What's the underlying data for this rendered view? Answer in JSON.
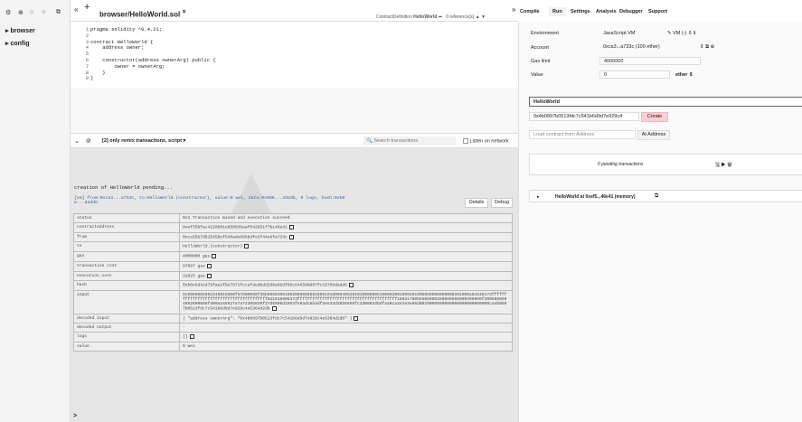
{
  "sidebar": {
    "toolbar_icons": [
      "gear-icon",
      "plus-icon",
      "github-icon",
      "swarm-icon",
      "copy-icon"
    ],
    "tree": [
      "browser",
      "config"
    ]
  },
  "tabs": {
    "prev_label": "«",
    "add_label": "+",
    "active": "browser/HelloWorld.sol",
    "close": "×",
    "next_label": "»"
  },
  "editor": {
    "header_left": "ContractDefinition",
    "header_name": "HelloWorld",
    "header_refs": "0 reference(s)",
    "lines": [
      {
        "n": "1",
        "t": "pragma solidity ^0.4.21;"
      },
      {
        "n": "2",
        "t": ""
      },
      {
        "n": "3",
        "t": "contract HelloWorld {"
      },
      {
        "n": "4",
        "t": "    address owner;"
      },
      {
        "n": "5",
        "t": ""
      },
      {
        "n": "6",
        "t": "    constructor(address ownerArg) public {"
      },
      {
        "n": "7",
        "t": "        owner = ownerArg;"
      },
      {
        "n": "8",
        "t": "    }"
      },
      {
        "n": "9",
        "t": "}"
      }
    ]
  },
  "terminal_bar": {
    "filter": "[2] only remix transactions, script",
    "search_placeholder": "Search transactions",
    "listen": "Listen on network"
  },
  "terminal": {
    "creation": "creation of HelloWorld pending...",
    "tx_line1": "[vm] from:0xca3...a733c, to:HelloWorld.(constructor), value:0 wei, data:0x608...4d2db, 0 logs, hash:0xb0",
    "tx_line2": "e...dadd6",
    "details": "Details",
    "debug": "Debug",
    "rows": [
      {
        "k": "status",
        "v": "0x1 Transaction mined and execution succeed"
      },
      {
        "k": "contractAddress",
        "v": "0xef35bfac4220981e850936aaf042951f7b146e41"
      },
      {
        "k": "from",
        "v": "0xca35b7d915458ef540ade6068dfe2f44e8fa733c"
      },
      {
        "k": "to",
        "v": "HelloWorld.(constructor)"
      },
      {
        "k": "gas",
        "v": "4000000 gas"
      },
      {
        "k": "transaction cost",
        "v": "97097 gas"
      },
      {
        "k": "execution cost",
        "v": "31025 gas"
      },
      {
        "k": "hash",
        "v": "0xb0e5d41d78fae2f9e7871fccafdedbdd296e86df95c646598907fc19709dadd6"
      },
      {
        "k": "input",
        "v": "0x6080604052348015600f57600080fd5b50604051602080608b833981018060405281019080805190602001909291905050508060008101000a81548173ffffffffffffffffffffffffffffffffffffffff021916908373ffffffffffffffffffffffffffffffffffffffff1602179055505060358060566000396000f3006080604052600080fd00a165627a7a72305820f27d8980d2954fe9adc6b4df3ee33d35b0658fc2d08843bdfaa0ca2e1e3e56d0029000000000000000000000000ca4b0897b0513fdc7c541b6d9d7e929c4e5364d2db"
      },
      {
        "k": "decoded input",
        "v": "{ \"address ownerArg\": \"0x4b0897b0513fdc7c541b6d9d7e929c4e5364d2db\" }"
      },
      {
        "k": "decoded output",
        "v": "-"
      },
      {
        "k": "logs",
        "v": "[]"
      },
      {
        "k": "value",
        "v": "0 wei"
      }
    ],
    "prompt": ">"
  },
  "right": {
    "tabs": [
      "Compile",
      "Run",
      "Settings",
      "Analysis",
      "Debugger",
      "Support"
    ],
    "environment_label": "Environment",
    "environment": "JavaScript VM",
    "vm_label": "VM (-)",
    "account_label": "Account",
    "account": "0xca3...a733c (100 ether)",
    "gas_label": "Gas limit",
    "gas": "4000000",
    "value_label": "Value",
    "value": "0",
    "unit": "ether",
    "contract": "HelloWorld",
    "ctor_arg": "0x4b0897b0513fdc7c541b6d9d7e929c4",
    "create": "Create",
    "load_placeholder": "Load contract from Address",
    "at_address": "At Address",
    "pending": "0 pending transactions",
    "instance": "HelloWorld at 0xef5...46e41 (memory)"
  },
  "colors": {
    "create_bg": "#f9d0d5",
    "accent": "#2a6ebb"
  }
}
